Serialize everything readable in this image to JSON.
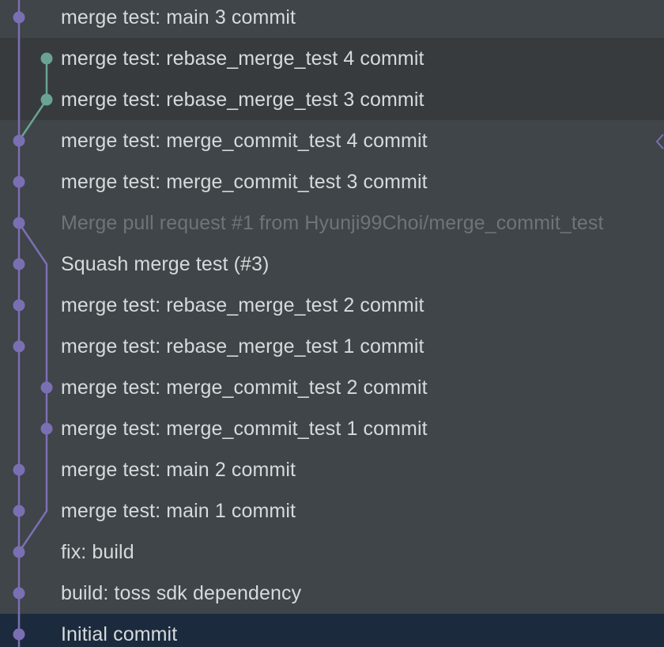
{
  "commits": [
    {
      "message": "merge test: main 3 commit"
    },
    {
      "message": "merge test: rebase_merge_test 4 commit"
    },
    {
      "message": "merge test: rebase_merge_test 3 commit"
    },
    {
      "message": "merge test: merge_commit_test 4 commit"
    },
    {
      "message": "merge test: merge_commit_test 3 commit"
    },
    {
      "message": "Merge pull request #1 from Hyunji99Choi/merge_commit_test"
    },
    {
      "message": "Squash merge test (#3)"
    },
    {
      "message": "merge test: rebase_merge_test 2 commit"
    },
    {
      "message": "merge test: rebase_merge_test 1 commit"
    },
    {
      "message": "merge test: merge_commit_test 2 commit"
    },
    {
      "message": "merge test: merge_commit_test 1 commit"
    },
    {
      "message": "merge test: main 2 commit"
    },
    {
      "message": "merge test: main 1 commit"
    },
    {
      "message": "fix: build"
    },
    {
      "message": "build: toss sdk dependency"
    },
    {
      "message": "Initial commit"
    }
  ],
  "colors": {
    "main_lane": "#7b6fb4",
    "branch_lane": "#6aa393",
    "background": "#3f4548",
    "highlight": "#373b3e",
    "selected": "#1b2a3d",
    "text": "#d6dadc",
    "dim_text": "#6e7479"
  }
}
